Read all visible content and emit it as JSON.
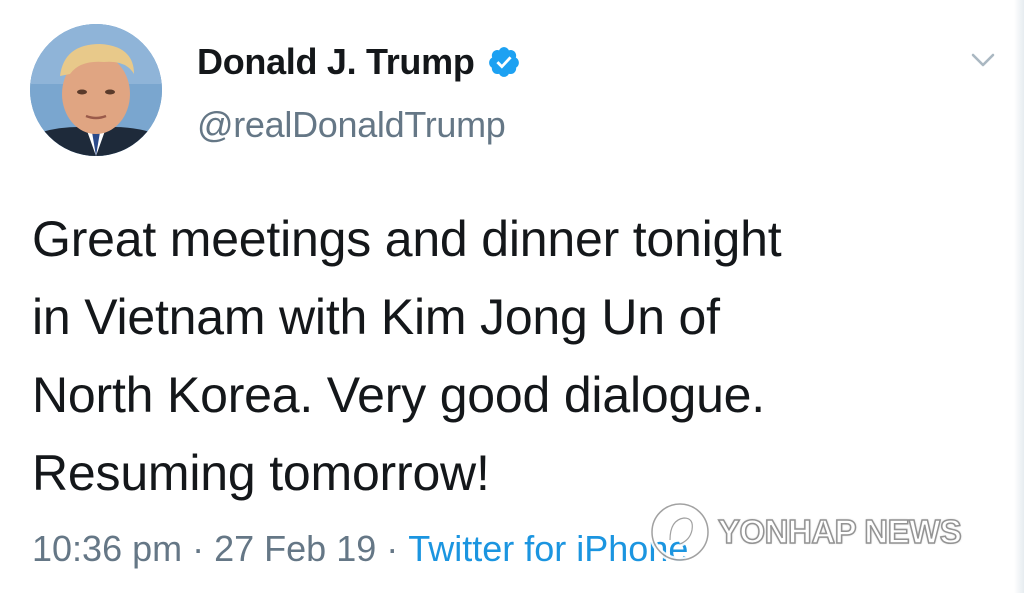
{
  "author": {
    "display_name": "Donald J. Trump",
    "handle": "@realDonaldTrump",
    "verified": true,
    "avatar_icon": "profile-photo",
    "verified_icon": "verified-badge-icon"
  },
  "tweet": {
    "text": "Great meetings and dinner tonight\nin Vietnam with Kim Jong Un of\nNorth Korea. Very good dialogue.\nResuming tomorrow!"
  },
  "meta": {
    "time": "10:36 pm",
    "separator": "·",
    "date": "27 Feb 19",
    "source": "Twitter for iPhone"
  },
  "menu": {
    "icon": "chevron-down-icon"
  },
  "watermark": {
    "text": "YONHAP NEWS"
  },
  "colors": {
    "text": "#14171a",
    "secondary": "#657786",
    "link": "#1b95e0",
    "verified": "#1da1f2"
  }
}
